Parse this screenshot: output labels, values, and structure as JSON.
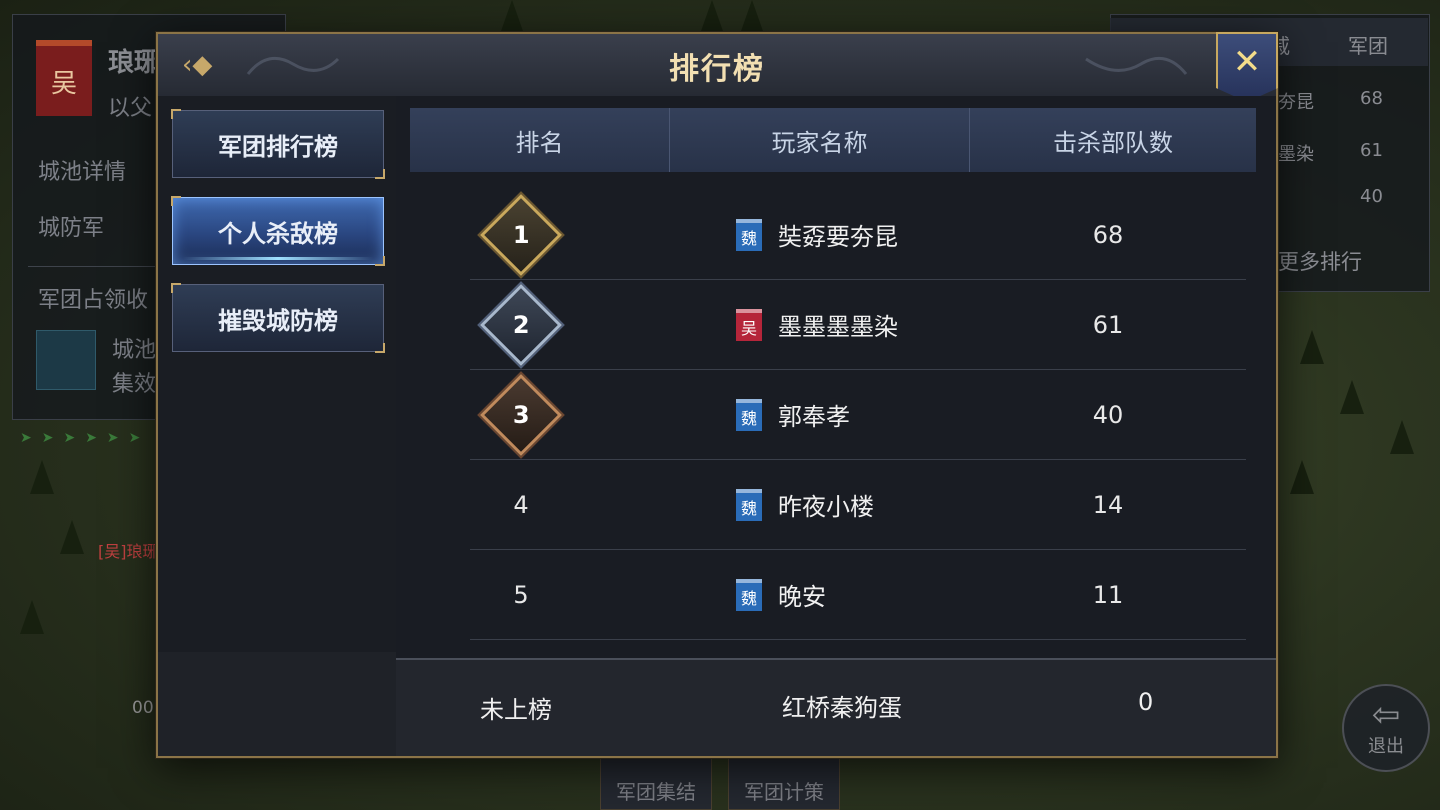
{
  "background": {
    "left_panel": {
      "flag_glyph": "吴",
      "city_name": "琅琊",
      "subtitle": "以父",
      "city_details": "城池详情",
      "city_guard": "城防军",
      "occupation": "军团占领收",
      "effect_line1": "城池",
      "effect_line2": "集效"
    },
    "right_panel": {
      "header_col1": "戚",
      "header_col2": "军团",
      "rows": [
        {
          "name": "夯昆",
          "value": "68"
        },
        {
          "name": "墨染",
          "value": "61"
        },
        {
          "name": "",
          "value": "40"
        }
      ],
      "more": "更多排行"
    },
    "red_tag": "[吴]琅琊",
    "count": "00",
    "bottom_buttons": [
      "军团集结",
      "军团计策"
    ],
    "exit_label": "退出",
    "exit_glyph": "⇦"
  },
  "modal": {
    "title": "排行榜",
    "back_glyph": "‹◆",
    "close_glyph": "✕",
    "tabs": [
      {
        "label": "军团排行榜",
        "active": false
      },
      {
        "label": "个人杀敌榜",
        "active": true
      },
      {
        "label": "摧毁城防榜",
        "active": false
      }
    ],
    "table": {
      "headers": [
        "排名",
        "玩家名称",
        "击杀部队数"
      ],
      "rows": [
        {
          "rank": "1",
          "medal": "gold",
          "faction": "魏",
          "faction_class": "wei",
          "name": "奘孬要夯昆",
          "kills": "68"
        },
        {
          "rank": "2",
          "medal": "silver",
          "faction": "吴",
          "faction_class": "wu",
          "name": "墨墨墨墨染",
          "kills": "61"
        },
        {
          "rank": "3",
          "medal": "bronze",
          "faction": "魏",
          "faction_class": "wei",
          "name": "郭奉孝",
          "kills": "40"
        },
        {
          "rank": "4",
          "medal": "",
          "faction": "魏",
          "faction_class": "wei",
          "name": "昨夜小楼",
          "kills": "14"
        },
        {
          "rank": "5",
          "medal": "",
          "faction": "魏",
          "faction_class": "wei",
          "name": "晚安",
          "kills": "11"
        }
      ]
    },
    "footer": {
      "rank": "未上榜",
      "name": "红桥秦狗蛋",
      "kills": "0"
    }
  }
}
